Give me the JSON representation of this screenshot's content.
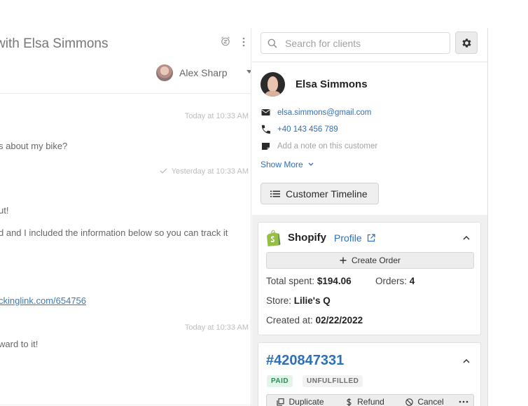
{
  "conversation": {
    "title": "with Elsa Simmons",
    "assignee": {
      "name": "Alex Sharp"
    },
    "messages": [
      {
        "timestamp": "Today at 10:33 AM",
        "lines": [
          "s about my bike?"
        ]
      },
      {
        "timestamp": "Yesterday at 10:33 AM",
        "lines": [
          "ut!",
          "d and I included the information below so you can track it",
          "ckinglink.com/654756"
        ]
      },
      {
        "timestamp": "Today at 10:33 AM",
        "lines": [
          "ward to it!"
        ]
      }
    ]
  },
  "sidebar": {
    "search": {
      "placeholder": "Search for clients",
      "value": ""
    },
    "customer": {
      "name": "Elsa Simmons",
      "email": "elsa.simmons@gmail.com",
      "phone": "+40 143 456 789",
      "note_placeholder": "Add a note on this customer"
    },
    "show_more_label": "Show More",
    "timeline_button_label": "Customer Timeline"
  },
  "shopify": {
    "title": "Shopify",
    "profile_label": "Profile",
    "create_order_label": "Create Order",
    "total_spent_label": "Total spent:",
    "total_spent_value": "$194.06",
    "orders_label": "Orders:",
    "orders_value": "4",
    "store_label": "Store:",
    "store_value": "Lilie's Q",
    "created_label": "Created at:",
    "created_value": "02/22/2022"
  },
  "order": {
    "number": "#420847331",
    "payment_status": "PAID",
    "fulfillment_status": "UNFULFILLED",
    "actions": {
      "duplicate": "Duplicate",
      "refund": "Refund",
      "cancel": "Cancel"
    }
  },
  "colors": {
    "link": "#2d6fb8",
    "paid_badge_bg": "#e3f4ea",
    "paid_badge_text": "#2e8a55",
    "shopify_green": "#95bf47"
  },
  "icons": [
    "snooze-icon",
    "more-vert-icon",
    "check-icon",
    "search-icon",
    "gear-icon",
    "email-icon",
    "phone-icon",
    "note-icon",
    "chevron-down-icon",
    "list-icon",
    "shopify-logo-icon",
    "external-link-icon",
    "chevron-up-icon",
    "plus-icon",
    "duplicate-icon",
    "dollar-icon",
    "cancel-icon",
    "more-horizontal-icon"
  ]
}
